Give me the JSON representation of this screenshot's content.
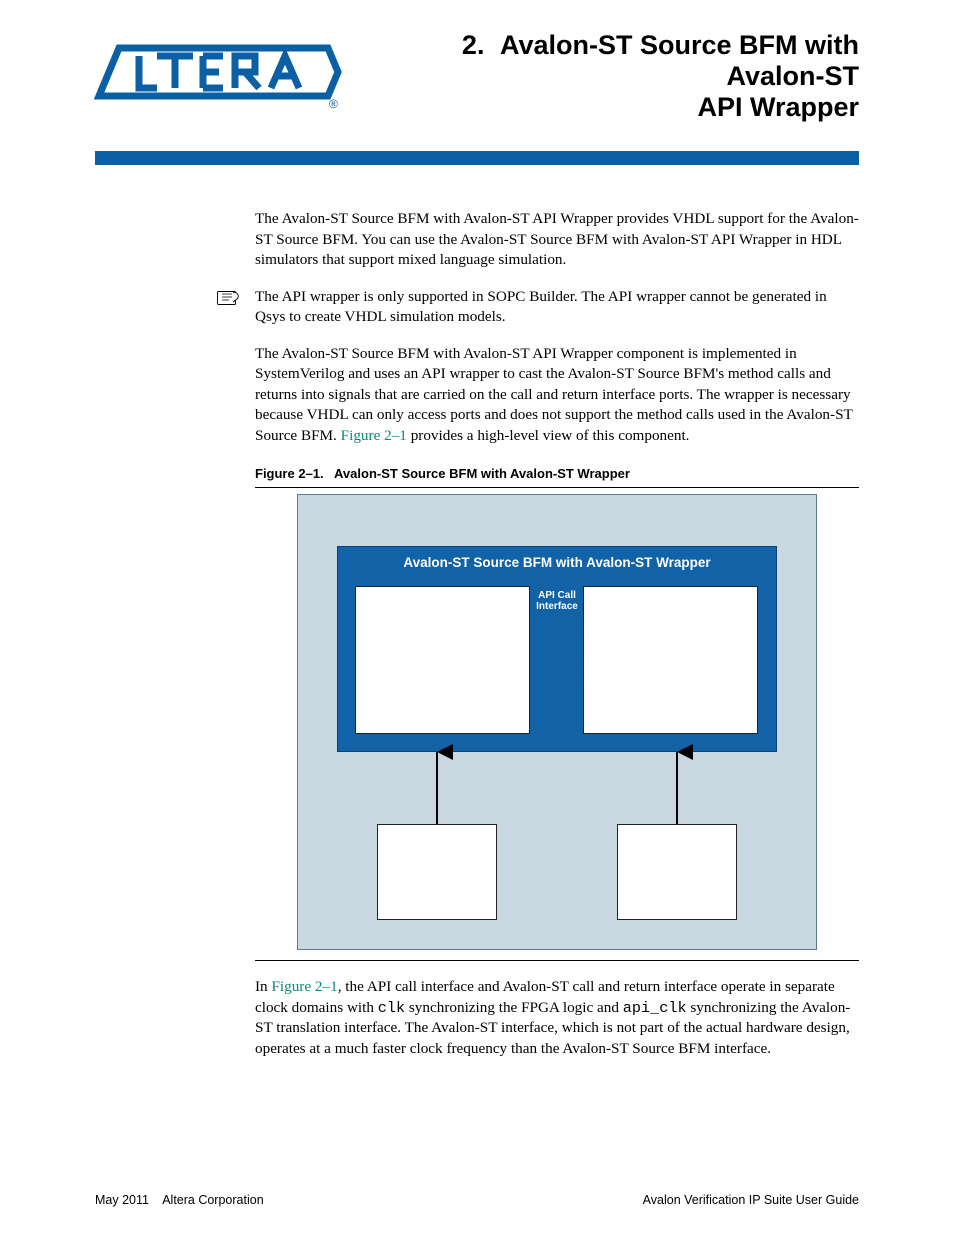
{
  "header": {
    "chapter_number": "2.",
    "chapter_title_line1": "Avalon-ST Source BFM with Avalon-ST",
    "chapter_title_line2": "API Wrapper"
  },
  "logo": {
    "registered_mark": "®"
  },
  "body": {
    "p1": "The Avalon-ST Source BFM with Avalon-ST API Wrapper provides VHDL support for the Avalon-ST Source BFM. You can use the Avalon-ST Source BFM with Avalon-ST API Wrapper in HDL simulators that support mixed language simulation.",
    "note": "The API wrapper is only supported in SOPC Builder. The API wrapper cannot be generated in Qsys to create VHDL simulation models.",
    "p2a": "The Avalon-ST Source BFM with Avalon-ST API Wrapper component is implemented in SystemVerilog and uses an API wrapper to cast the Avalon-ST Source BFM's method calls and returns into signals that are carried on the call and return interface ports. The wrapper is necessary because VHDL can only access ports and does not support the method calls used in the Avalon-ST Source BFM. ",
    "p2_xref": "Figure 2–1",
    "p2b": " provides a high-level view of this component.",
    "p3a": "In ",
    "p3_xref": "Figure 2–1",
    "p3b": ", the API call interface and Avalon-ST call and return interface operate in separate clock domains with ",
    "p3c": "clk",
    "p3d": " synchronizing the FPGA logic and ",
    "p3e": "api_clk",
    "p3f": " synchronizing the Avalon-ST translation interface. The Avalon-ST interface, which is not part of the actual hardware design, operates at a much faster clock frequency than the Avalon-ST Source BFM interface."
  },
  "figure": {
    "caption_label": "Figure 2–1.",
    "caption_text": "Avalon-ST Source BFM with Avalon-ST Wrapper",
    "blue_box_title": "Avalon-ST Source BFM with Avalon-ST Wrapper",
    "api_label_line1": "API Call",
    "api_label_line2": "Interface"
  },
  "footer": {
    "left_date": "May 2011",
    "left_corp": "Altera Corporation",
    "right": "Avalon Verification IP Suite User Guide"
  },
  "colors": {
    "accent_blue": "#0b5fa5",
    "xref_teal": "#0a8a78",
    "diagram_bg": "#c9d7e1"
  }
}
